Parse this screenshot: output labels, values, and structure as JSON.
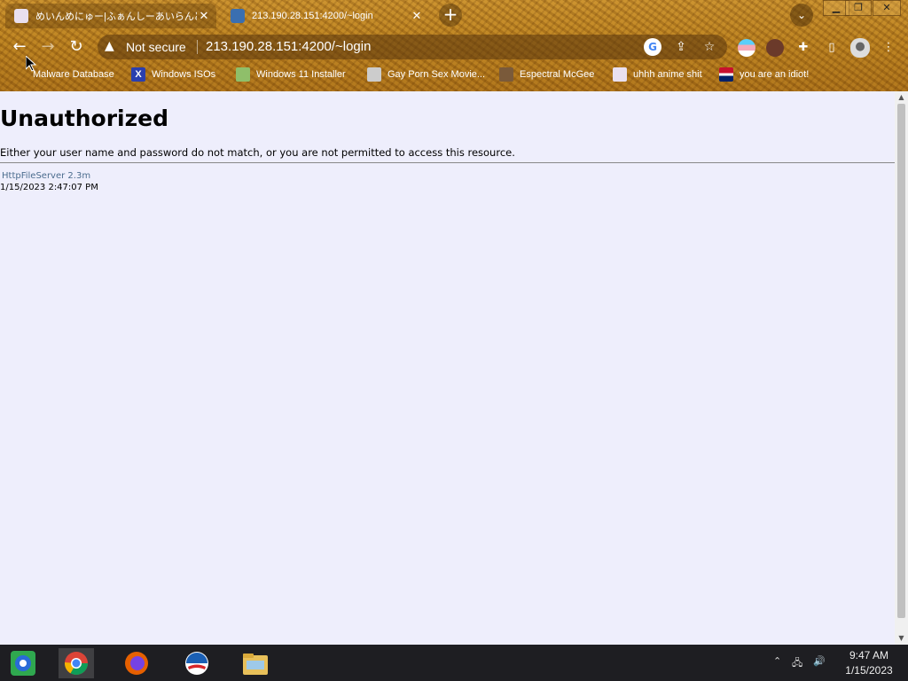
{
  "tabs": [
    {
      "title": "めいんめにゅー|ふぁんしーあいらんど",
      "active": true
    },
    {
      "title": "213.190.28.151:4200/~login",
      "active": false
    }
  ],
  "toolbar": {
    "security_label": "Not secure",
    "url": "213.190.28.151:4200/~login"
  },
  "bookmarks": [
    "Malware Database",
    "Windows ISOs",
    "Windows 11 Installer",
    "Gay Porn Sex Movie...",
    "Espectral McGee",
    "uhhh anime shit",
    "you are an idiot!"
  ],
  "page": {
    "heading": "Unauthorized",
    "message": "Either your user name and password do not match, or you are not permitted to access this resource.",
    "server_link": "HttpFileServer 2.3m",
    "timestamp": "1/15/2023 2:47:07 PM"
  },
  "taskbar": {
    "clock_time": "9:47 AM",
    "clock_date": "1/15/2023"
  },
  "colors": {
    "page_bg": "#eeeefc",
    "link": "#4b6c8e",
    "taskbar_bg": "#1e1e22"
  }
}
